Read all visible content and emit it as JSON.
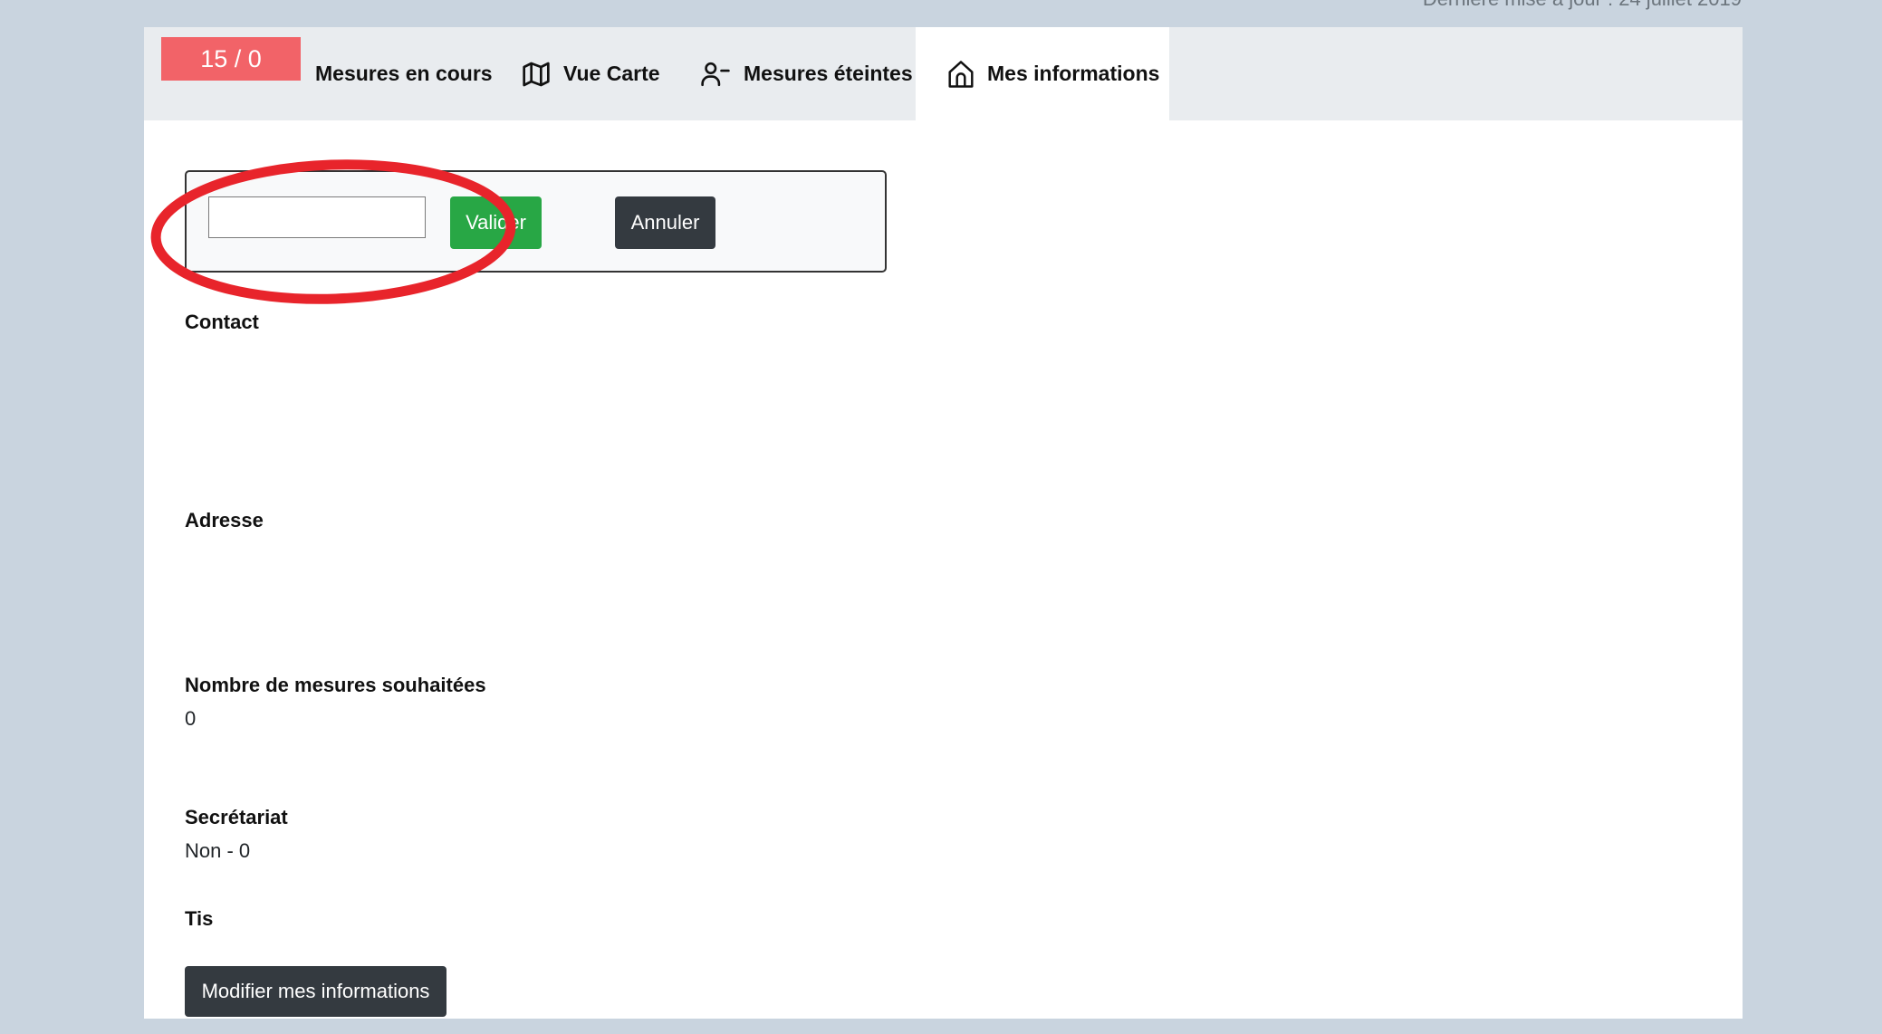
{
  "header_note": "Dernière mise à jour : 24 juillet 2019",
  "counter": "15 / 0",
  "tabs": [
    {
      "label": "Mesures en cours",
      "icon": "none"
    },
    {
      "label": "Vue Carte",
      "icon": "map-icon"
    },
    {
      "label": "Mesures éteintes",
      "icon": "person-minus-icon"
    },
    {
      "label": "Mes informations",
      "icon": "house-icon",
      "active": true
    }
  ],
  "edit": {
    "input_value": "",
    "validate_label": "Valider",
    "cancel_label": "Annuler"
  },
  "annotation": {
    "color": "#e8242b",
    "shape": "ellipse"
  },
  "sections": {
    "contact": {
      "label": "Contact",
      "value": ""
    },
    "address": {
      "label": "Adresse",
      "value": ""
    },
    "measures": {
      "label": "Nombre de mesures souhaitées",
      "value": "0"
    },
    "secretariat": {
      "label": "Secrétariat",
      "value": "Non - 0"
    },
    "tis": {
      "label": "Tis",
      "value": ""
    }
  },
  "modify_label": "Modifier mes informations",
  "colors": {
    "page_bg": "#c9d4df",
    "tabbar_bg": "#e9ecef",
    "counter_bg": "#f26368",
    "validate_bg": "#28a745",
    "dark_button_bg": "#343a40"
  }
}
